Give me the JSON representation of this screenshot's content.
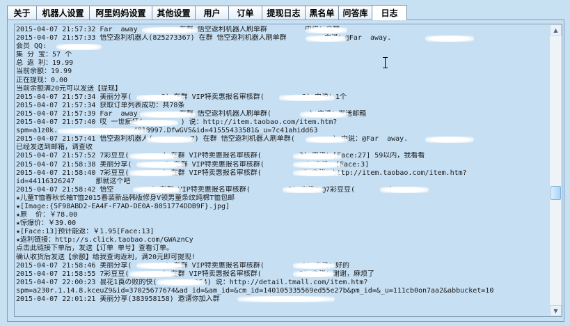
{
  "tabs": [
    {
      "label": "关于",
      "active": false
    },
    {
      "label": "机器人设置",
      "active": false
    },
    {
      "label": "阿里妈妈设置",
      "active": false
    },
    {
      "label": "其他设置",
      "active": false
    },
    {
      "label": "用户",
      "active": false
    },
    {
      "label": "订单",
      "active": false
    },
    {
      "label": "提现日志",
      "active": false
    },
    {
      "label": "黑名单",
      "active": false
    },
    {
      "label": "问答库",
      "active": false
    },
    {
      "label": "日志",
      "active": true
    }
  ],
  "log_lines": [
    "2015-04-07 21:57:32 Far  away          在群 悟空返利机器人刷单群         中说：余额",
    "2015-04-07 21:57:33 悟空返利机器人(825273367) 在群 悟空返利机器人刷单群         中说：@Far  away.",
    "会员 QQ:",
    "集 分 宝：57 个",
    "总 返 利：19.99",
    "当前余额：19.99",
    "正在提现：0.00",
    "当前余额满20元可以发送【提现】",
    "2015-04-07 21:57:34 美丽分享(       8) 在群 VIP特卖惠报名审核群(         3) 中说：1个",
    "2015-04-07 21:57:34 获取订单列表成功：共78条",
    "2015-04-07 21:57:39 Far  away          在群 悟空返利机器人刷单群(         ) 中说：发送邮箱",
    "2015-04-07 21:57:40 哎 一世痴狂(         ) 说：http://item.taobao.com/item.htm?",
    "spm=a1z0k.                 .4018997.DfwGV5&id=41555433581&_u=7c41ahidd63",
    "2015-04-07 21:57:41 悟空返利机器人(         7) 在群 悟空返利机器人刷单群(         ) 中说：@Far  away.",
    "已经发送到邮箱，请查收",
    "2015-04-07 21:57:52 7彩豆豆(        ) 在群 VIP特卖惠报名审核群(         3) 中说：[Face:27] 59以内，我看看",
    "2015-04-07 21:58:38 美丽分享(        ) 在群 VIP特卖惠报名审核群(          ) 中说：[Face:3]",
    "2015-04-07 21:58:40 7彩豆豆(        ) 在群 VIP特卖惠报名审核群(          ) 中说：http://item.taobao.com/item.htm?",
    "id=44116326247     那就这个吧",
    "2015-04-07 21:58:42 悟空         ) 在群 VIP特卖惠报名审核群(         3) 中说：@7彩豆豆(        )",
    "★儿童T恤春秋长袖T恤2015春装新品韩版修身V领男童条纹纯棉T恤包邮",
    "★[Image:{5F98ABD2-EA4F-F7AD-DE0A-8051774DDB9F}.jpg]",
    "★原  价：￥78.00",
    "★惊爆价：￥39.00",
    "★[Face:13]预计能返：￥1.95[Face:13]",
    "★返利链接：http://s.click.taobao.com/GWAznCy",
    "点击此链接下单后，发送【订单 单号】查看订单。",
    "确认收货后发送【余额】给我查询返利，满20元即可提现!",
    "2015-04-07 21:58:46 美丽分享(        ) 在群 VIP特卖惠报名审核群(         3) 中说：好的",
    "2015-04-07 21:58:55 7彩豆豆(        ) 在群 VIP特卖惠报名审核群(         3) 中说：谢谢，麻烦了",
    "2015-04-07 22:00:23 昙花1莨の败的快(         354) 说：http://detail.tmall.com/item.htm?",
    "spm=a230r.1.14.8.kceuZ9&id=37025677674&ad_id=&am_id=&cm_id=140105335569ed55e27b&pm_id=&_u=111cb0on7aa2&abbucket=10",
    "2015-04-07 22:01:21 美丽分享(383958158) 邀请你加入群"
  ]
}
